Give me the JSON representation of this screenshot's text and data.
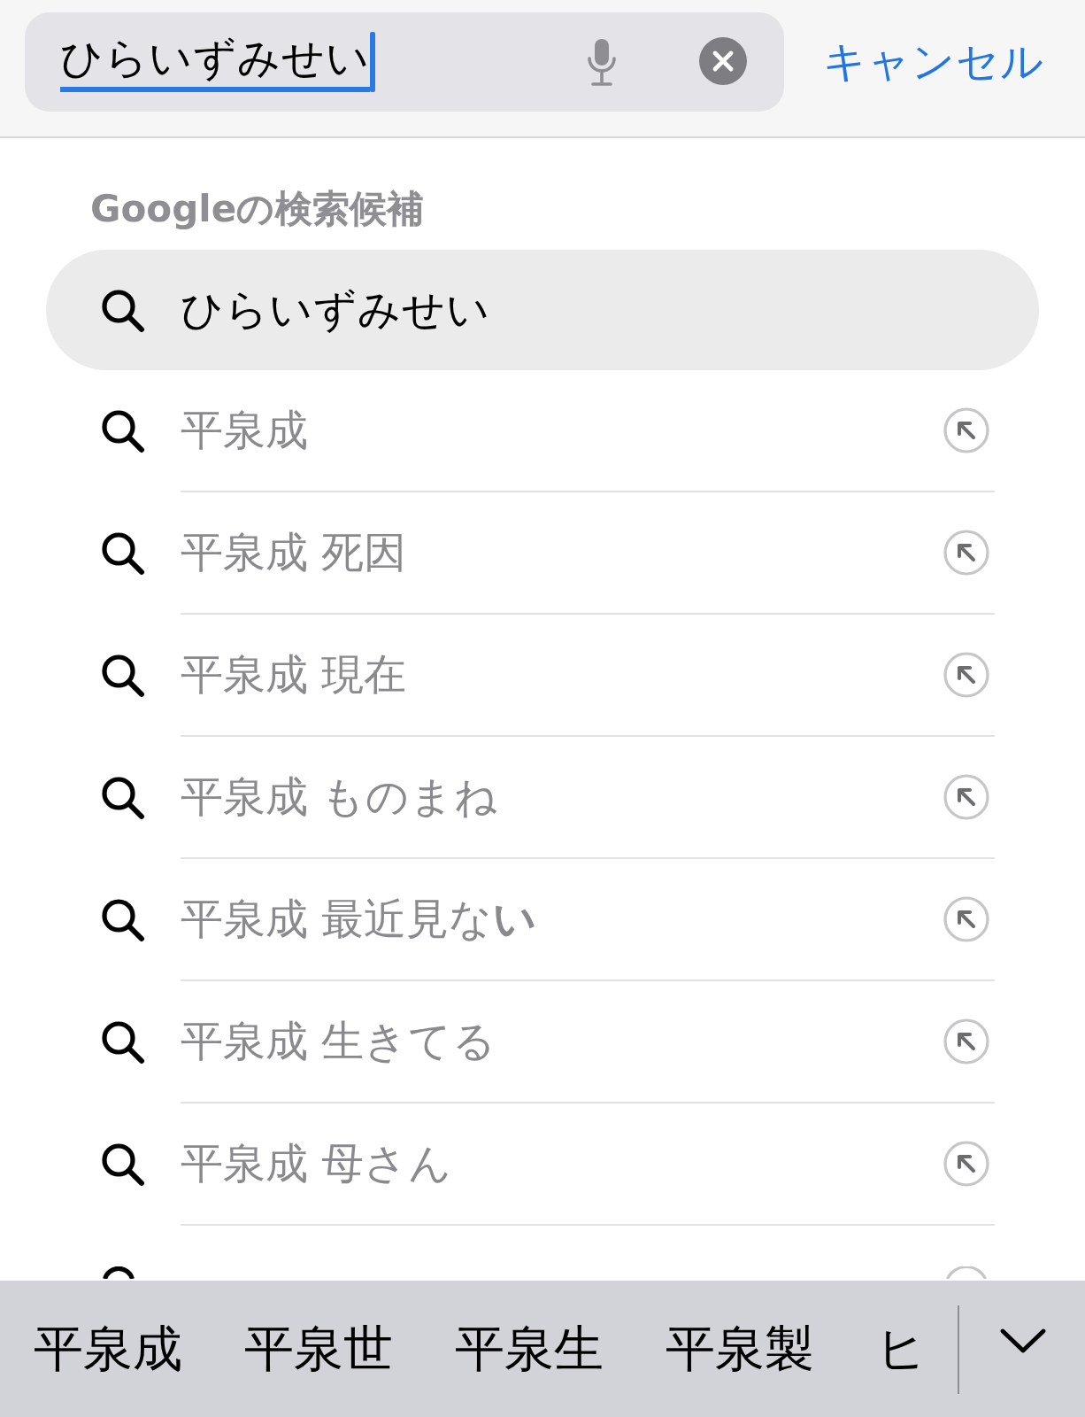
{
  "search_bar": {
    "field": {
      "value": "ひらいずみせい",
      "composing": true
    },
    "cancel": "キャンセル"
  },
  "suggestions": {
    "heading": "Googleの検索候補",
    "rows": [
      {
        "kind": "query",
        "text": "ひらいずみせい",
        "selected": true
      },
      {
        "kind": "suggestion",
        "text": "平泉成",
        "selected": false
      },
      {
        "kind": "suggestion",
        "text": "平泉成 死因",
        "selected": false
      },
      {
        "kind": "suggestion",
        "text": "平泉成 現在",
        "selected": false
      },
      {
        "kind": "suggestion",
        "text": "平泉成 ものまね",
        "selected": false
      },
      {
        "kind": "suggestion",
        "text": "平泉成 最近見な**い**",
        "selected": false
      },
      {
        "kind": "suggestion",
        "text": "平泉成 生きてる",
        "selected": false
      },
      {
        "kind": "suggestion",
        "text": "平泉成 母さん",
        "selected": false
      }
    ]
  },
  "keyboard": {
    "candidates": [
      "平泉成",
      "平泉世",
      "平泉生",
      "平泉製",
      "ヒ"
    ]
  }
}
